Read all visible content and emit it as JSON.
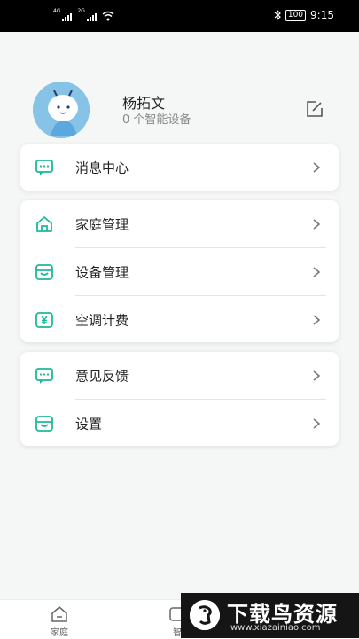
{
  "status_bar": {
    "signal_1_label": "4G",
    "signal_2_label": "2G",
    "battery": "100",
    "time": "9:15"
  },
  "profile": {
    "username": "杨拓文",
    "device_count": "0 个智能设备"
  },
  "menu": {
    "message_center": "消息中心",
    "home_management": "家庭管理",
    "device_management": "设备管理",
    "ac_billing": "空调计费",
    "feedback": "意见反馈",
    "settings": "设置"
  },
  "tabbar": {
    "home": "家庭",
    "smart": "智"
  },
  "watermark": {
    "title": "下载鸟资源",
    "url": "www.xiazainiao.com"
  },
  "colors": {
    "accent": "#1fb89a",
    "background": "#f5f6f6"
  }
}
